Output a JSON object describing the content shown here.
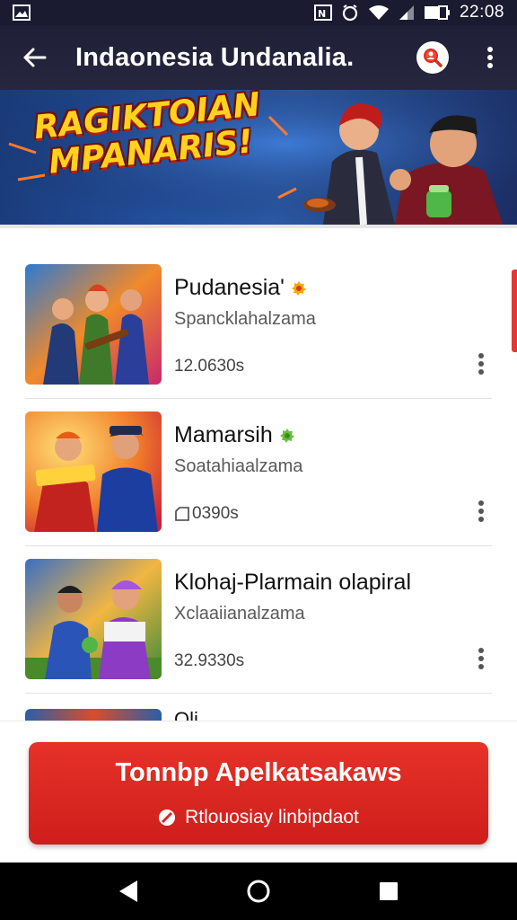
{
  "status_bar": {
    "time": "22:08",
    "icons": [
      "gallery-icon",
      "nfc-icon",
      "alarm-icon",
      "wifi-icon",
      "signal-icon",
      "battery-icon"
    ]
  },
  "app_bar": {
    "title": "Indaonesia Undanalia.",
    "icons": [
      "back-arrow-icon",
      "search-icon",
      "more-vert-icon"
    ]
  },
  "banner": {
    "title_line1": "RAGIKTOIAN",
    "title_line2": "MPANARIS!"
  },
  "list": {
    "items": [
      {
        "title": "Pudanesia'",
        "subtitle": "Spancklahalzama",
        "size": "12.0630s",
        "badge_color": "#f2a900"
      },
      {
        "title": "Mamarsih",
        "subtitle": "Soatahiaalzama",
        "size": "0390s",
        "badge_color": "#6abf3b"
      },
      {
        "title": "Klohaj-Plarmain olapiral",
        "subtitle": "Xclaaiianalzama",
        "size": "32.9330s"
      }
    ],
    "partial_item_title": "Oli"
  },
  "cta": {
    "title": "Tonnbp Apelkatsakaws",
    "subtitle": "Rtlouosiay linbipdaot"
  },
  "colors": {
    "accent_red": "#e02b24",
    "app_bar": "#1f2038",
    "banner_text": "#ffd21e"
  },
  "nav_bar": {
    "icons": [
      "back-triangle-icon",
      "home-circle-icon",
      "recents-square-icon"
    ]
  }
}
